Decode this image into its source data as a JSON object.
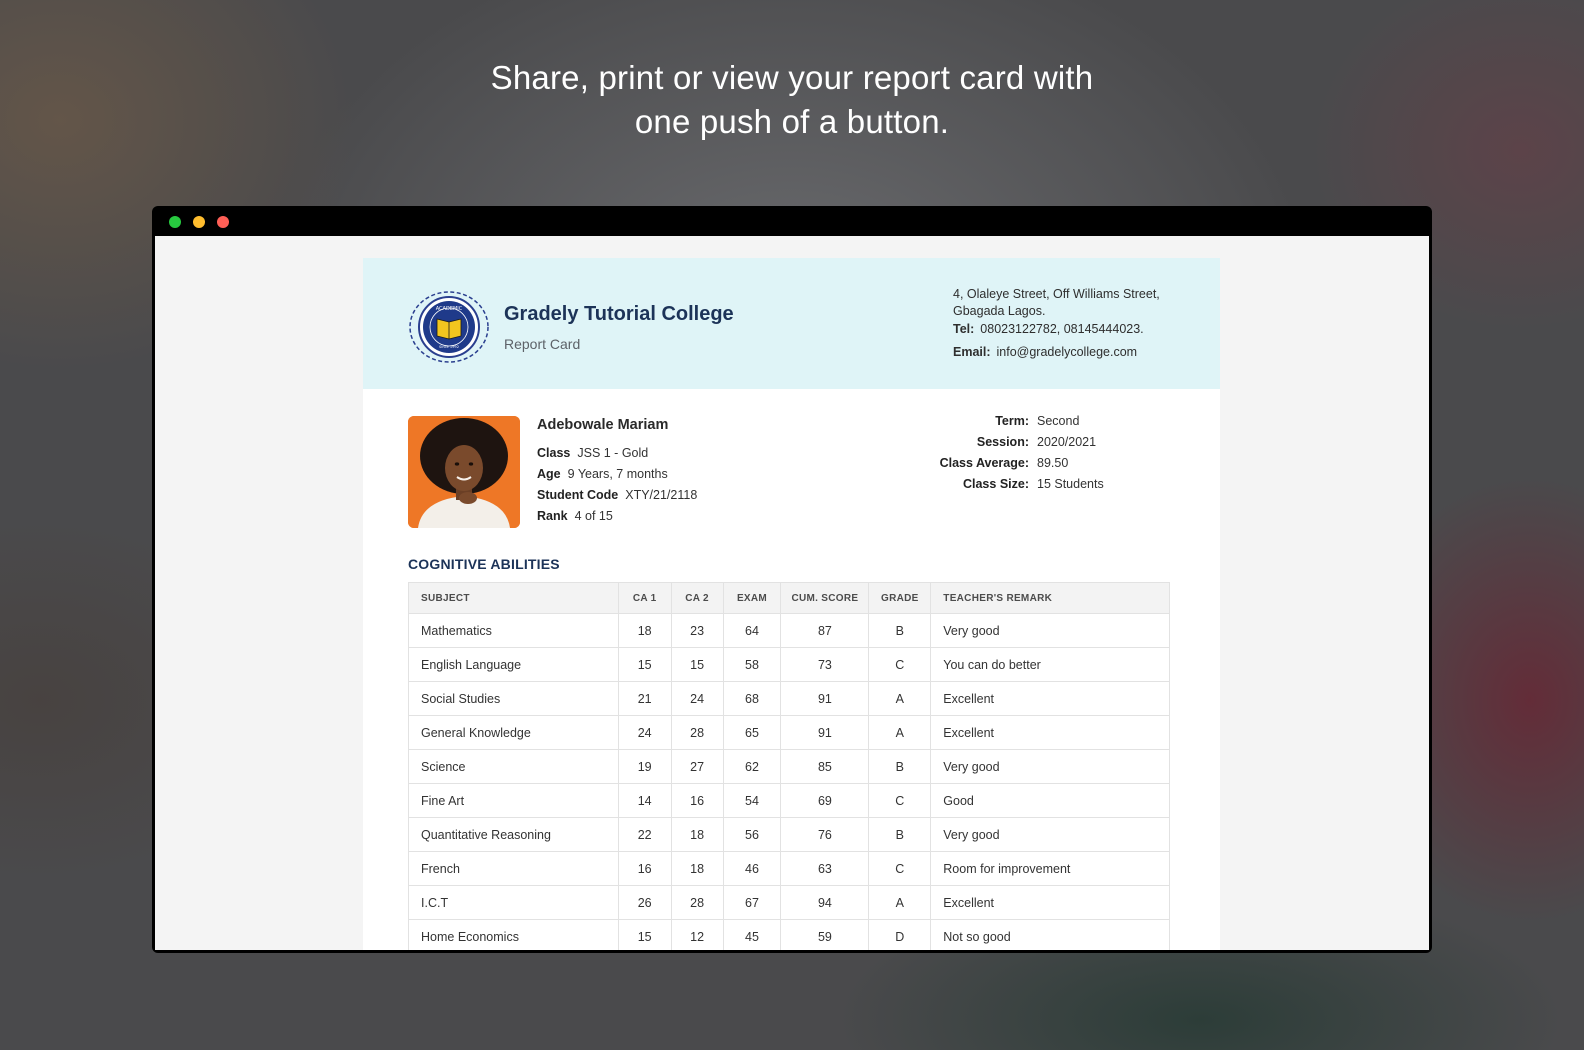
{
  "hero": {
    "line1": "Share, print or view your report card with",
    "line2": "one push of a button."
  },
  "school": {
    "name": "Gradely Tutorial College",
    "document": "Report Card",
    "address": "4, Olaleye Street, Off Williams Street, Gbagada Lagos.",
    "tel_label": "Tel:",
    "tel": "08023122782, 08145444023.",
    "email_label": "Email:",
    "email": "info@gradelycollege.com",
    "logo_text_top": "ACADEMIC",
    "logo_text_bottom": "Since 1992"
  },
  "student": {
    "name": "Adebowale Mariam",
    "class_label": "Class",
    "class": "JSS 1 - Gold",
    "age_label": "Age",
    "age": "9 Years, 7 months",
    "code_label": "Student Code",
    "code": "XTY/21/2118",
    "rank_label": "Rank",
    "rank": "4 of 15"
  },
  "term": {
    "term_label": "Term:",
    "term": "Second",
    "session_label": "Session:",
    "session": "2020/2021",
    "avg_label": "Class Average:",
    "avg": "89.50",
    "size_label": "Class Size:",
    "size": "15 Students"
  },
  "cognitive": {
    "title": "COGNITIVE ABILITIES",
    "headers": [
      "SUBJECT",
      "CA 1",
      "CA 2",
      "EXAM",
      "CUM. SCORE",
      "GRADE",
      "TEACHER'S REMARK"
    ],
    "rows": [
      [
        "Mathematics",
        "18",
        "23",
        "64",
        "87",
        "B",
        "Very good"
      ],
      [
        "English Language",
        "15",
        "15",
        "58",
        "73",
        "C",
        "You can do better"
      ],
      [
        "Social Studies",
        "21",
        "24",
        "68",
        "91",
        "A",
        "Excellent"
      ],
      [
        "General Knowledge",
        "24",
        "28",
        "65",
        "91",
        "A",
        "Excellent"
      ],
      [
        "Science",
        "19",
        "27",
        "62",
        "85",
        "B",
        "Very good"
      ],
      [
        "Fine Art",
        "14",
        "16",
        "54",
        "69",
        "C",
        "Good"
      ],
      [
        "Quantitative Reasoning",
        "22",
        "18",
        "56",
        "76",
        "B",
        "Very good"
      ],
      [
        "French",
        "16",
        "18",
        "46",
        "63",
        "C",
        "Room for improvement"
      ],
      [
        "I.C.T",
        "26",
        "28",
        "67",
        "94",
        "A",
        "Excellent"
      ],
      [
        "Home Economics",
        "15",
        "12",
        "45",
        "59",
        "D",
        "Not so good"
      ]
    ]
  },
  "colors": {
    "header_bg": "#dff4f7",
    "brand_navy": "#1c3358",
    "dot_green": "#27c93f",
    "dot_yellow": "#ffbd2e",
    "dot_red": "#ff5f56"
  }
}
